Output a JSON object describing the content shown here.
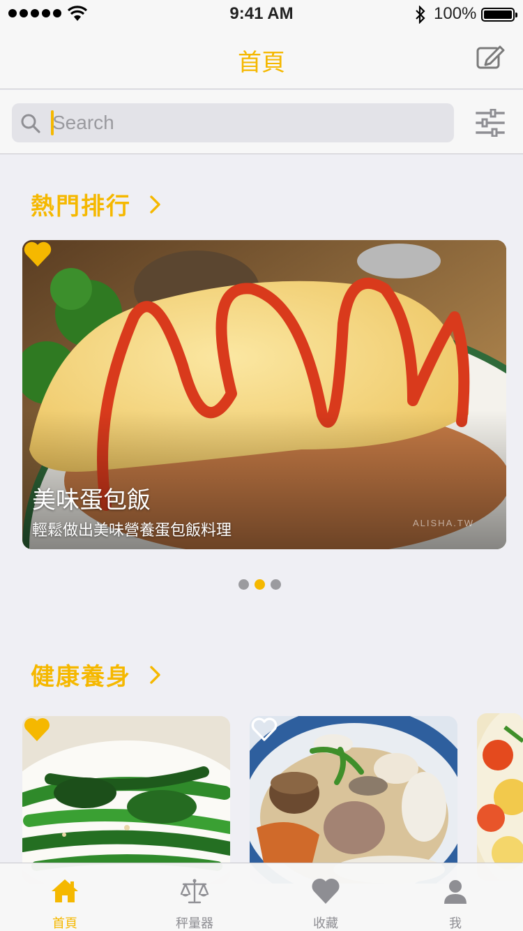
{
  "status_bar": {
    "time": "9:41 AM",
    "battery": "100%"
  },
  "nav": {
    "title": "首頁",
    "compose_icon": "compose-icon"
  },
  "search": {
    "placeholder": "Search",
    "value": "",
    "filter_icon": "filter-sliders-icon"
  },
  "sections": [
    {
      "title": "熱門排行"
    },
    {
      "title": "健康養身"
    }
  ],
  "featured": {
    "title": "美味蛋包飯",
    "subtitle": "輕鬆做出美味營養蛋包飯料理",
    "watermark": "ALISHA.TW",
    "favorited": true,
    "page_count": 3,
    "active_page": 2
  },
  "recipes": [
    {
      "dish": "greens",
      "favorited": true
    },
    {
      "dish": "soup",
      "favorited": false
    }
  ],
  "tabs": [
    {
      "label": "首頁",
      "icon": "home-icon",
      "active": true
    },
    {
      "label": "秤量器",
      "icon": "scale-icon",
      "active": false
    },
    {
      "label": "收藏",
      "icon": "heart-icon",
      "active": false
    },
    {
      "label": "我",
      "icon": "person-icon",
      "active": false
    }
  ],
  "colors": {
    "accent": "#f5b800",
    "inactive": "#8e8e93",
    "background": "#efeff4"
  }
}
